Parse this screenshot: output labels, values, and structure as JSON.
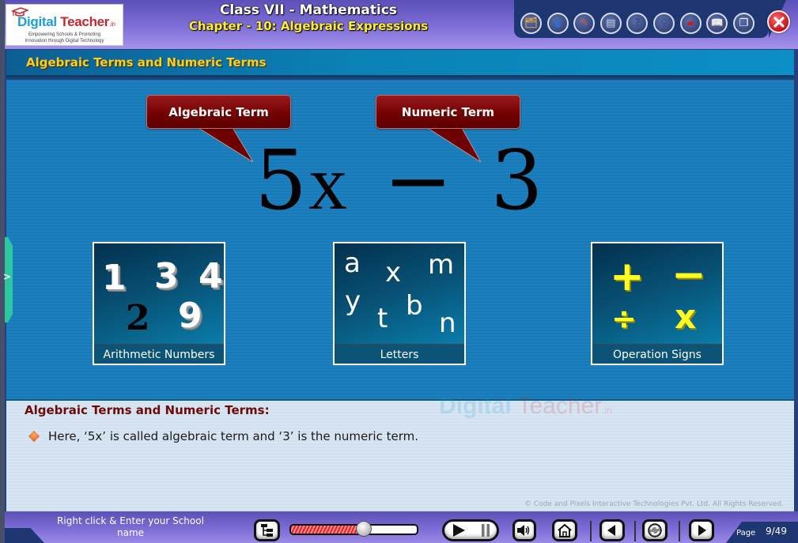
{
  "header": {
    "logo": {
      "brand_part1": "Digital",
      "brand_part2": " Teacher",
      "brand_suffix": ".in",
      "tagline_line1": "Empowering Schools & Promoting",
      "tagline_line2": "Innovation through Digital Technology"
    },
    "title": "Class VII - Mathematics",
    "subtitle": "Chapter - 10: Algebraic Expressions",
    "toolbar": [
      {
        "name": "folder-clock-icon",
        "glyph": "🗂"
      },
      {
        "name": "book-icon",
        "glyph": "▮"
      },
      {
        "name": "sketch-pad-icon",
        "glyph": "✎"
      },
      {
        "name": "notes-icon",
        "glyph": "▤"
      },
      {
        "name": "help-icon",
        "glyph": "?"
      },
      {
        "name": "search-zoom-icon",
        "glyph": "⚲"
      },
      {
        "name": "red-book-icon",
        "glyph": "▰"
      },
      {
        "name": "open-book-icon",
        "glyph": "📖"
      },
      {
        "name": "window-switch-icon",
        "glyph": "❐"
      }
    ],
    "close_icon": "close-icon"
  },
  "section": {
    "title": "Algebraic Terms and Numeric Terms"
  },
  "stage": {
    "callout_algebraic": "Algebraic Term",
    "callout_numeric": "Numeric Term",
    "expression": {
      "coefficient": "5",
      "variable": "x",
      "operator": "−",
      "constant": "3"
    },
    "cards": [
      {
        "label": "Arithmetic Numbers",
        "items": [
          "1",
          "3",
          "4",
          "2",
          "9"
        ]
      },
      {
        "label": "Letters",
        "items": [
          "a",
          "x",
          "m",
          "y",
          "t",
          "b",
          "n"
        ]
      },
      {
        "label": "Operation Signs",
        "items": [
          "+",
          "−",
          "÷",
          "x"
        ]
      }
    ]
  },
  "notes": {
    "heading": "Algebraic Terms and Numeric Terms:",
    "bullets": [
      "Here, ‘5x’ is called algebraic term and ‘3’ is the numeric term."
    ],
    "watermark": {
      "part1": "Digital",
      "part2": " Teacher",
      "suffix": ".in"
    },
    "copyright": "© Code and Pixels Interactive Technologies  Pvt. Ltd. All Rights Reserved."
  },
  "footer": {
    "school_prompt": "Right click & Enter your School name",
    "progress_fraction": 0.58,
    "page_label": "Page",
    "page_number": "9/49",
    "colors": {
      "progress": "#e0242a",
      "accent_bar": "#1e3672"
    }
  }
}
